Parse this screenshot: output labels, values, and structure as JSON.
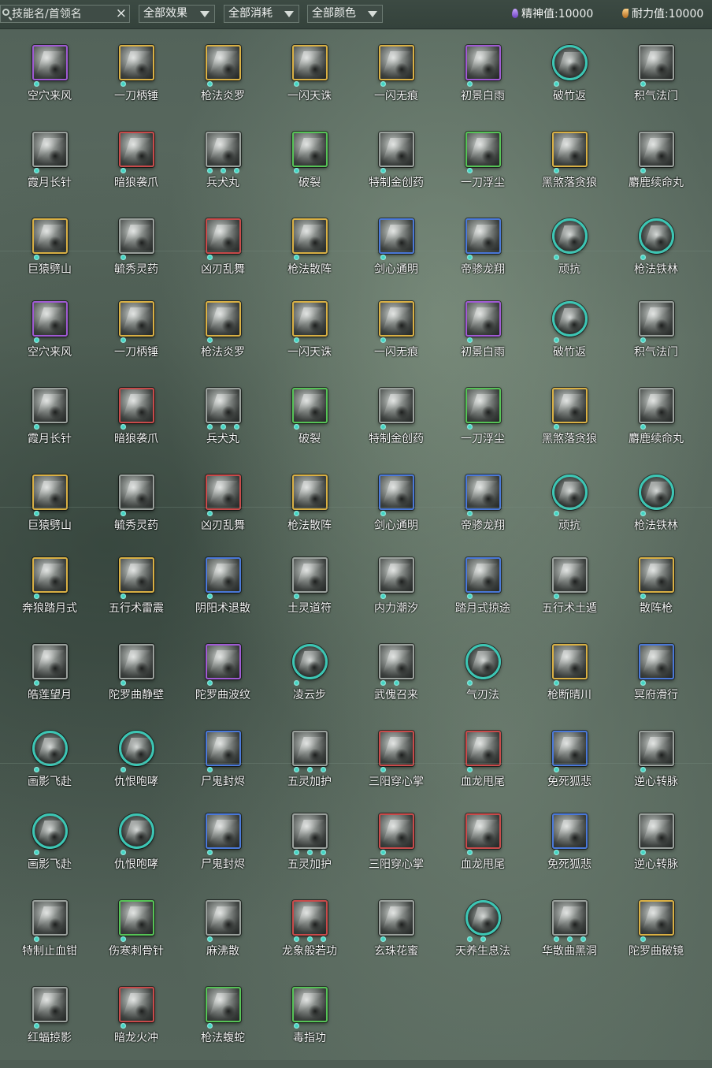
{
  "toolbar": {
    "search_placeholder": "技能名/首领名",
    "clear_icon": "×",
    "filters": [
      "全部效果",
      "全部消耗",
      "全部颜色"
    ],
    "spirit_label": "精神值:10000",
    "stamina_label": "耐力值:10000"
  },
  "skills": [
    {
      "name": "空穴来风",
      "frame": "purple",
      "dots": 1
    },
    {
      "name": "一刀柄锤",
      "frame": "gold",
      "dots": 1
    },
    {
      "name": "枪法炎罗",
      "frame": "gold",
      "dots": 1
    },
    {
      "name": "一闪天诛",
      "frame": "gold",
      "dots": 1
    },
    {
      "name": "一闪无痕",
      "frame": "gold",
      "dots": 1
    },
    {
      "name": "初景白雨",
      "frame": "purple",
      "dots": 1
    },
    {
      "name": "破竹返",
      "frame": "round",
      "dots": 1
    },
    {
      "name": "积气法门",
      "frame": "gray",
      "dots": 1
    },
    {
      "name": "霞月长针",
      "frame": "gray",
      "dots": 1
    },
    {
      "name": "暗狼袭爪",
      "frame": "red",
      "dots": 1
    },
    {
      "name": "兵犬丸",
      "frame": "gray",
      "dots": 3
    },
    {
      "name": "破裂",
      "frame": "green",
      "dots": 1
    },
    {
      "name": "特制金创药",
      "frame": "gray",
      "dots": 1
    },
    {
      "name": "一刀浮尘",
      "frame": "green",
      "dots": 1
    },
    {
      "name": "黑煞落贪狼",
      "frame": "gold",
      "dots": 1
    },
    {
      "name": "麝鹿续命丸",
      "frame": "gray",
      "dots": 1
    },
    {
      "name": "巨猿劈山",
      "frame": "gold",
      "dots": 1
    },
    {
      "name": "毓秀灵药",
      "frame": "gray",
      "dots": 1
    },
    {
      "name": "凶刃乱舞",
      "frame": "red",
      "dots": 1
    },
    {
      "name": "枪法散阵",
      "frame": "gold",
      "dots": 1
    },
    {
      "name": "剑心通明",
      "frame": "blue",
      "dots": 1
    },
    {
      "name": "帝骖龙翔",
      "frame": "blue",
      "dots": 1
    },
    {
      "name": "顽抗",
      "frame": "round",
      "dots": 1
    },
    {
      "name": "枪法铁林",
      "frame": "round",
      "dots": 1
    },
    {
      "name": "空穴来风",
      "frame": "purple",
      "dots": 1
    },
    {
      "name": "一刀柄锤",
      "frame": "gold",
      "dots": 1
    },
    {
      "name": "枪法炎罗",
      "frame": "gold",
      "dots": 1
    },
    {
      "name": "一闪天诛",
      "frame": "gold",
      "dots": 1
    },
    {
      "name": "一闪无痕",
      "frame": "gold",
      "dots": 1
    },
    {
      "name": "初景白雨",
      "frame": "purple",
      "dots": 1
    },
    {
      "name": "破竹返",
      "frame": "round",
      "dots": 1
    },
    {
      "name": "积气法门",
      "frame": "gray",
      "dots": 1
    },
    {
      "name": "霞月长针",
      "frame": "gray",
      "dots": 1
    },
    {
      "name": "暗狼袭爪",
      "frame": "red",
      "dots": 1
    },
    {
      "name": "兵犬丸",
      "frame": "gray",
      "dots": 3
    },
    {
      "name": "破裂",
      "frame": "green",
      "dots": 1
    },
    {
      "name": "特制金创药",
      "frame": "gray",
      "dots": 1
    },
    {
      "name": "一刀浮尘",
      "frame": "green",
      "dots": 1
    },
    {
      "name": "黑煞落贪狼",
      "frame": "gold",
      "dots": 1
    },
    {
      "name": "麝鹿续命丸",
      "frame": "gray",
      "dots": 1
    },
    {
      "name": "巨猿劈山",
      "frame": "gold",
      "dots": 1
    },
    {
      "name": "毓秀灵药",
      "frame": "gray",
      "dots": 1
    },
    {
      "name": "凶刃乱舞",
      "frame": "red",
      "dots": 1
    },
    {
      "name": "枪法散阵",
      "frame": "gold",
      "dots": 1
    },
    {
      "name": "剑心通明",
      "frame": "blue",
      "dots": 1
    },
    {
      "name": "帝骖龙翔",
      "frame": "blue",
      "dots": 1
    },
    {
      "name": "顽抗",
      "frame": "round",
      "dots": 1
    },
    {
      "name": "枪法铁林",
      "frame": "round",
      "dots": 1
    },
    {
      "name": "奔狼踏月式",
      "frame": "gold",
      "dots": 1
    },
    {
      "name": "五行术雷震",
      "frame": "gold",
      "dots": 1
    },
    {
      "name": "阴阳术退散",
      "frame": "blue",
      "dots": 1
    },
    {
      "name": "土灵道符",
      "frame": "gray",
      "dots": 1
    },
    {
      "name": "内力潮汐",
      "frame": "gray",
      "dots": 1
    },
    {
      "name": "踏月式掠途",
      "frame": "blue",
      "dots": 1
    },
    {
      "name": "五行术土遁",
      "frame": "gray",
      "dots": 1
    },
    {
      "name": "散阵枪",
      "frame": "gold",
      "dots": 1
    },
    {
      "name": "皓莲望月",
      "frame": "gray",
      "dots": 1
    },
    {
      "name": "陀罗曲静壁",
      "frame": "gray",
      "dots": 1
    },
    {
      "name": "陀罗曲波纹",
      "frame": "purple",
      "dots": 1
    },
    {
      "name": "凌云步",
      "frame": "round",
      "dots": 1
    },
    {
      "name": "武傀召来",
      "frame": "gray",
      "dots": 2
    },
    {
      "name": "气刃法",
      "frame": "round",
      "dots": 1
    },
    {
      "name": "枪断晴川",
      "frame": "gold",
      "dots": 1
    },
    {
      "name": "冥府滑行",
      "frame": "blue",
      "dots": 1
    },
    {
      "name": "画影飞赴",
      "frame": "round",
      "dots": 1
    },
    {
      "name": "仇恨咆哮",
      "frame": "round",
      "dots": 1
    },
    {
      "name": "尸鬼封烬",
      "frame": "blue",
      "dots": 1
    },
    {
      "name": "五灵加护",
      "frame": "gray",
      "dots": 3
    },
    {
      "name": "三阳穿心掌",
      "frame": "red",
      "dots": 1
    },
    {
      "name": "血龙甩尾",
      "frame": "red",
      "dots": 1
    },
    {
      "name": "免死狐悲",
      "frame": "blue",
      "dots": 1
    },
    {
      "name": "逆心转脉",
      "frame": "gray",
      "dots": 1
    },
    {
      "name": "画影飞赴",
      "frame": "round",
      "dots": 1
    },
    {
      "name": "仇恨咆哮",
      "frame": "round",
      "dots": 1
    },
    {
      "name": "尸鬼封烬",
      "frame": "blue",
      "dots": 1
    },
    {
      "name": "五灵加护",
      "frame": "gray",
      "dots": 3
    },
    {
      "name": "三阳穿心掌",
      "frame": "red",
      "dots": 1
    },
    {
      "name": "血龙甩尾",
      "frame": "red",
      "dots": 1
    },
    {
      "name": "免死狐悲",
      "frame": "blue",
      "dots": 1
    },
    {
      "name": "逆心转脉",
      "frame": "gray",
      "dots": 1
    },
    {
      "name": "特制止血钳",
      "frame": "gray",
      "dots": 1
    },
    {
      "name": "伤寒刺骨针",
      "frame": "green",
      "dots": 1
    },
    {
      "name": "麻沸散",
      "frame": "gray",
      "dots": 1
    },
    {
      "name": "龙象般若功",
      "frame": "red",
      "dots": 3
    },
    {
      "name": "玄珠花蜜",
      "frame": "gray",
      "dots": 1
    },
    {
      "name": "天养生息法",
      "frame": "round",
      "dots": 2
    },
    {
      "name": "华散曲黑洞",
      "frame": "gray",
      "dots": 3
    },
    {
      "name": "陀罗曲破镜",
      "frame": "gold",
      "dots": 1
    },
    {
      "name": "红蝠掠影",
      "frame": "gray",
      "dots": 1
    },
    {
      "name": "暗龙火冲",
      "frame": "red",
      "dots": 1
    },
    {
      "name": "枪法蝮蛇",
      "frame": "green",
      "dots": 1
    },
    {
      "name": "毒指功",
      "frame": "green",
      "dots": 1
    }
  ]
}
